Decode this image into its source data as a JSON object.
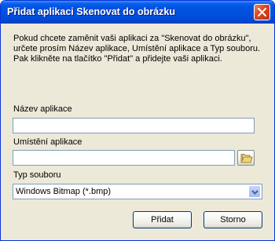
{
  "window": {
    "title": "Přidat aplikaci Skenovat do obrázku",
    "close_icon": "close-icon"
  },
  "description": "Pokud chcete zaměnit vaši aplikaci za \"Skenovat do obrázku\", určete prosím Název aplikace, Umístění aplikace a Typ souboru.\nPak klikněte na tlačítko \"Přidat\" a přidejte vaši aplikaci.",
  "fields": {
    "app_name": {
      "label": "Název aplikace",
      "value": ""
    },
    "app_location": {
      "label": "Umístění aplikace",
      "value": "",
      "browse_icon": "folder-icon"
    },
    "file_type": {
      "label": "Typ souboru",
      "selected": "Windows Bitmap (*.bmp)"
    }
  },
  "buttons": {
    "add": "Přidat",
    "cancel": "Storno"
  },
  "colors": {
    "title_bar": "#0053E1",
    "close_button": "#D9441E",
    "dialog_background": "#ECE9D8",
    "input_border": "#7F9DB9"
  }
}
